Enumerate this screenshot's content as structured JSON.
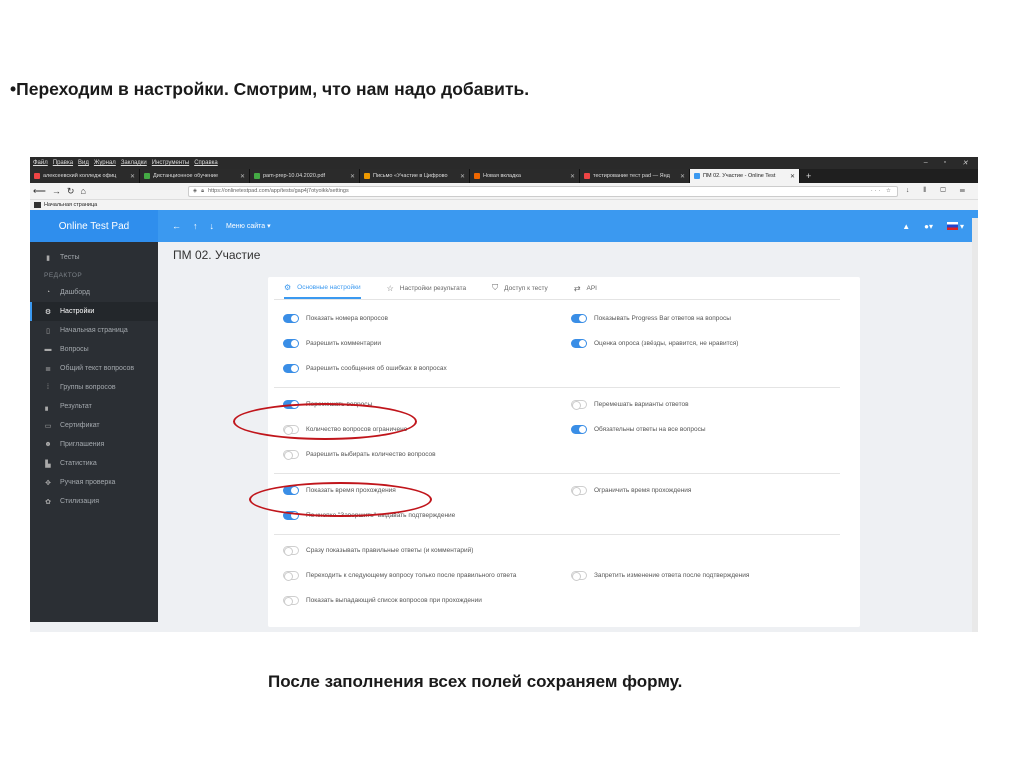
{
  "slide": {
    "title": "•Переходим в настройки. Смотрим, что нам надо добавить.",
    "bottom_text": "После заполнения всех полей сохраняем форму."
  },
  "browser": {
    "menu": [
      "Файл",
      "Правка",
      "Вид",
      "Журнал",
      "Закладки",
      "Инструменты",
      "Справка"
    ],
    "tabs": [
      {
        "title": "алексеевский колледж офиц"
      },
      {
        "title": "Дистанционное обучение"
      },
      {
        "title": "pam-prep-10.04.2020.pdf"
      },
      {
        "title": "Письмо «Участие в Цифрово"
      },
      {
        "title": "Новая вкладка"
      },
      {
        "title": "тестирование тест pad — Янд"
      },
      {
        "title": "ПМ 02. Участие - Online Test"
      }
    ],
    "url": "https://onlinetestpad.com/app/tests/gap4j7otyoikk/settings",
    "bookmark": "Начальная страница"
  },
  "app": {
    "brand": "Online Test Pad",
    "site_menu": "Меню сайта",
    "sidebar": {
      "tests": "Тесты",
      "section": "РЕДАКТОР",
      "items": [
        {
          "label": "Дашборд",
          "icon": "dashboard-icon"
        },
        {
          "label": "Настройки",
          "icon": "gear-icon"
        },
        {
          "label": "Начальная страница",
          "icon": "page-icon"
        },
        {
          "label": "Вопросы",
          "icon": "questions-icon"
        },
        {
          "label": "Общий текст вопросов",
          "icon": "text-icon"
        },
        {
          "label": "Группы вопросов",
          "icon": "groups-icon"
        },
        {
          "label": "Результат",
          "icon": "chart-icon"
        },
        {
          "label": "Сертификат",
          "icon": "certificate-icon"
        },
        {
          "label": "Приглашения",
          "icon": "users-icon"
        },
        {
          "label": "Статистика",
          "icon": "stats-icon"
        },
        {
          "label": "Ручная проверка",
          "icon": "check-icon"
        },
        {
          "label": "Стилизация",
          "icon": "palette-icon"
        }
      ]
    },
    "page_title": "ПМ 02. Участие",
    "tabs": [
      "Основные настройки",
      "Настройки результата",
      "Доступ к тесту",
      "API"
    ],
    "options": {
      "left": [
        {
          "label": "Показать номера вопросов",
          "on": true
        },
        {
          "label": "Разрешить комментарии",
          "on": true
        },
        {
          "label": "Разрешить сообщения об ошибках в вопросах",
          "on": true
        },
        {
          "label": "Перемешать вопросы",
          "on": true
        },
        {
          "label": "Количество вопросов ограничено",
          "on": false
        },
        {
          "label": "Разрешить выбирать количество вопросов",
          "on": false
        },
        {
          "label": "Показать время прохождения",
          "on": true
        },
        {
          "label": "По кнопке \"Завершить\" выдавать подтверждение",
          "on": true
        },
        {
          "label": "Сразу показывать правильные ответы (и комментарий)",
          "on": false
        },
        {
          "label": "Переходить к следующему вопросу только после правильного ответа",
          "on": false
        },
        {
          "label": "Показать выпадающий список вопросов при прохождении",
          "on": false
        }
      ],
      "right": [
        {
          "label": "Показывать Progress Bar ответов на вопросы",
          "on": true
        },
        {
          "label": "Оценка опроса (звёзды, нравится, не нравится)",
          "on": true
        },
        {
          "label": "Перемешать варианты ответов",
          "on": false
        },
        {
          "label": "Обязательны ответы на все вопросы",
          "on": true
        },
        {
          "label": "Ограничить время прохождения",
          "on": false
        },
        {
          "label": "Запретить изменение ответа после подтверждения",
          "on": false
        }
      ]
    },
    "colors": {
      "accent": "#3b99f0",
      "annotation": "#c0151b",
      "sidebar": "#2b2f34"
    }
  }
}
